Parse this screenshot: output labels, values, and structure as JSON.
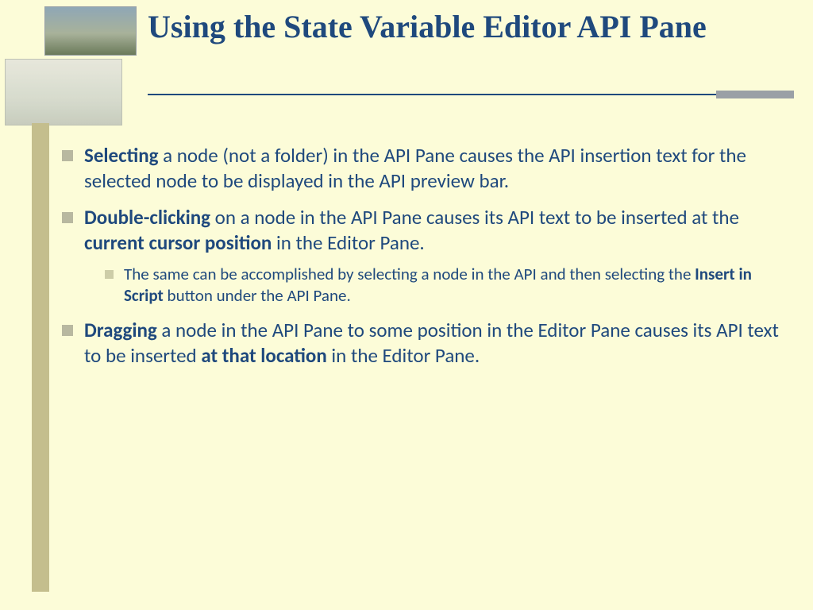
{
  "title": "Using the State Variable Editor API Pane",
  "bullets": {
    "b1_bold": "Selecting",
    "b1_rest": " a node (not a folder) in the API Pane causes the API insertion text for the selected node to be displayed in the API preview bar.",
    "b2_bold": "Double-clicking",
    "b2_mid1": " on a node in the API Pane causes its API text to be inserted at the ",
    "b2_bold2": "current cursor position",
    "b2_rest": " in the Editor Pane.",
    "b2_sub_pre": "The same can be accomplished by selecting a node in the API and then selecting the ",
    "b2_sub_bold": "Insert in Script",
    "b2_sub_post": " button under the API Pane.",
    "b3_bold": "Dragging",
    "b3_mid1": " a node in the API Pane to some position in the Editor Pane causes its API text to be inserted ",
    "b3_bold2": "at that location",
    "b3_rest": " in the Editor Pane."
  }
}
